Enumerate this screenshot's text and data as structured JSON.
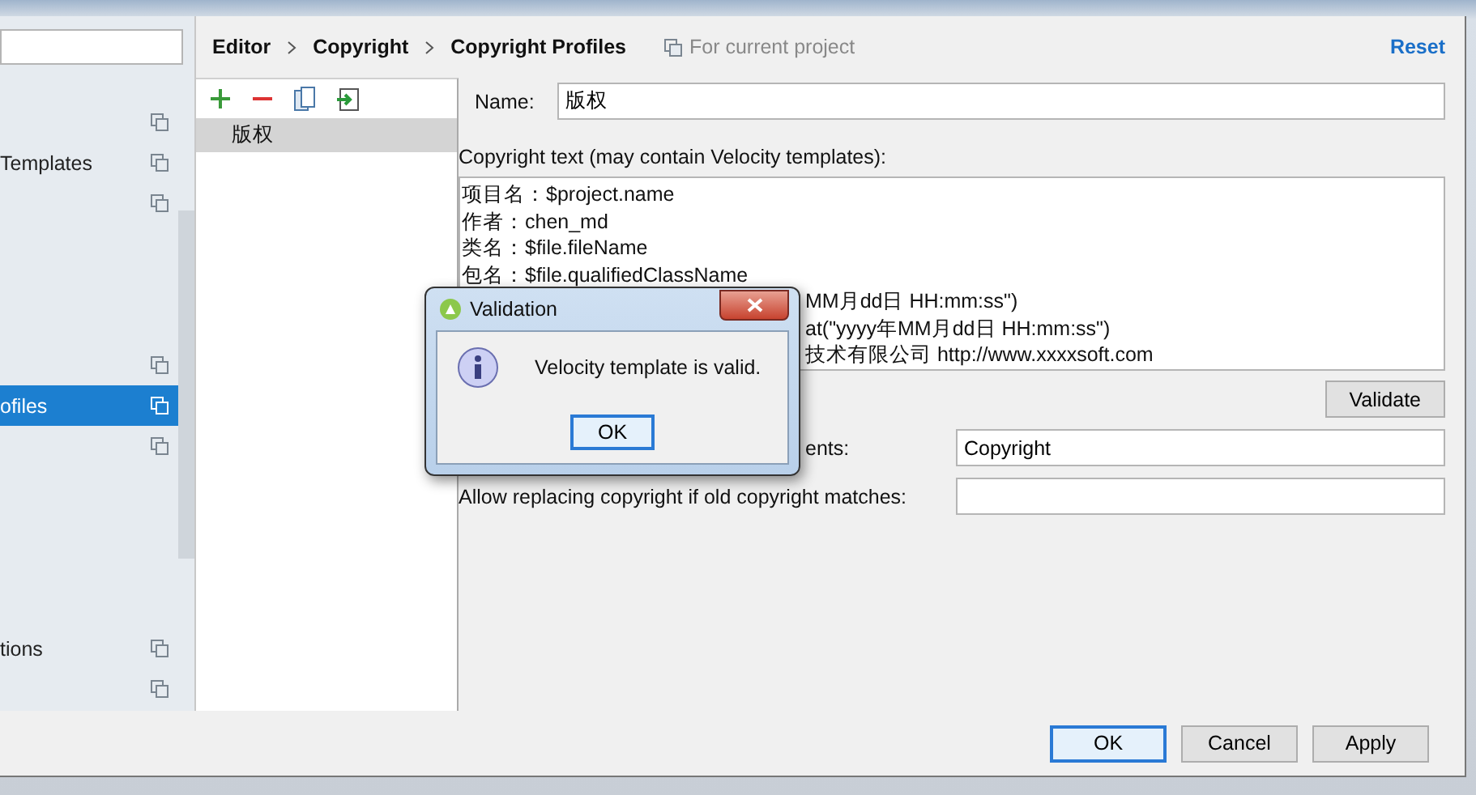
{
  "sidebar": {
    "items": [
      {
        "kind": "entry",
        "selected": false
      },
      {
        "kind": "entry",
        "label": "Templates",
        "selected": false
      },
      {
        "kind": "entry",
        "selected": false
      },
      {
        "kind": "spacer"
      },
      {
        "kind": "spacer"
      },
      {
        "kind": "spacer"
      },
      {
        "kind": "entry",
        "selected": false
      },
      {
        "kind": "entry",
        "label": "ofiles",
        "selected": true
      },
      {
        "kind": "entry",
        "selected": false
      },
      {
        "kind": "spacer"
      },
      {
        "kind": "spacer"
      },
      {
        "kind": "spacer"
      },
      {
        "kind": "spacer"
      },
      {
        "kind": "entry",
        "label": "tions",
        "selected": false
      },
      {
        "kind": "entry",
        "selected": false
      }
    ]
  },
  "breadcrumbs": [
    "Editor",
    "Copyright",
    "Copyright Profiles"
  ],
  "scope_note": "For current project",
  "reset_link": "Reset",
  "profiles": {
    "toolbar": [
      {
        "kind": "add"
      },
      {
        "kind": "remove"
      },
      {
        "kind": "copy"
      },
      {
        "kind": "import"
      }
    ],
    "items": [
      {
        "label": "版权",
        "selected": true
      }
    ]
  },
  "form": {
    "name_label": "Name:",
    "name_value": "版权",
    "text_label": "Copyright text (may contain Velocity templates):",
    "text_lines": [
      {
        "kind": "full",
        "text": "项目名：$project.name"
      },
      {
        "kind": "full",
        "text": "作者：chen_md"
      },
      {
        "kind": "full",
        "text": "类名：$file.fileName"
      },
      {
        "kind": "full",
        "text": "包名：$file.qualifiedClassName"
      },
      {
        "kind": "partial",
        "text": "MM月dd日 HH:mm:ss\")"
      },
      {
        "kind": "partial",
        "text": "at(\"yyyy年MM月dd日 HH:mm:ss\")"
      },
      {
        "kind": "partial",
        "text": "技术有限公司  http://www.xxxxsoft.com"
      }
    ],
    "validate_button": "Validate",
    "fields": [
      {
        "kind": "partial",
        "label": "ents:",
        "value": "Copyright"
      },
      {
        "kind": "full",
        "label": "Allow replacing copyright if old copyright matches:"
      }
    ]
  },
  "footer_buttons": [
    {
      "label": "OK",
      "selected": true
    },
    {
      "label": "Cancel",
      "selected": false
    },
    {
      "label": "Apply",
      "selected": false
    }
  ],
  "dialog": {
    "title": "Validation",
    "message": "Velocity template is valid.",
    "button": "OK"
  }
}
